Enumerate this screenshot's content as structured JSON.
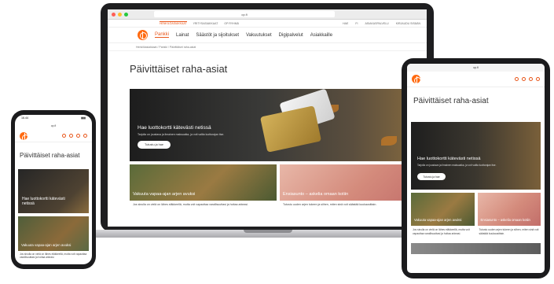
{
  "site": {
    "title": "Päivittäiset raha-asiat",
    "url": "op.fi",
    "tabs": [
      "HENKILÖASIAKKAAT",
      "YRITYSASIAKKAAT",
      "OP RYHMÄ"
    ],
    "util_right": [
      "FI",
      "SV",
      "EN",
      "ASIAKASPALVELU",
      "SULJE"
    ],
    "search_label": "HAE",
    "login_label": "KIRJAUDU SISÄÄN",
    "nav": [
      "Pankki",
      "Lainat",
      "Säästöt ja sijoitukset",
      "Vakuutukset",
      "Digipalvelut",
      "Asiakkaille"
    ],
    "breadcrumb": "Henkilöasiakkaat  /  Pankki  /  Päivittäiset raha-asiat",
    "hero": {
      "heading": "Hae luottokortti kätevästi netissä",
      "body": "Tarjolla on joustava ja ilmainen maksuaika, ja voit valita luottorajan itse.",
      "button": "Tutustu ja hae"
    },
    "tiles": [
      {
        "caption": "Vakuuta vapaa-ajan arjen avuksi",
        "text": "Jos sinulla on vielä on lähes eläkkeellä, mutta voit vapauttaa varallisuuttasi ja hoitaa arkeasi."
      },
      {
        "caption": "Ensiasunto – askelia omaan kotiin",
        "text": "Tutustu uuden arjen tukeen ja siihen, miten sinä voit säästää kuukausittain."
      }
    ]
  },
  "phone": {
    "time": "16.44",
    "url": "op.fi"
  },
  "tablet": {
    "url": "op.fi"
  },
  "colors": {
    "brand": "#ff6a10",
    "accent": "#e8561a"
  }
}
